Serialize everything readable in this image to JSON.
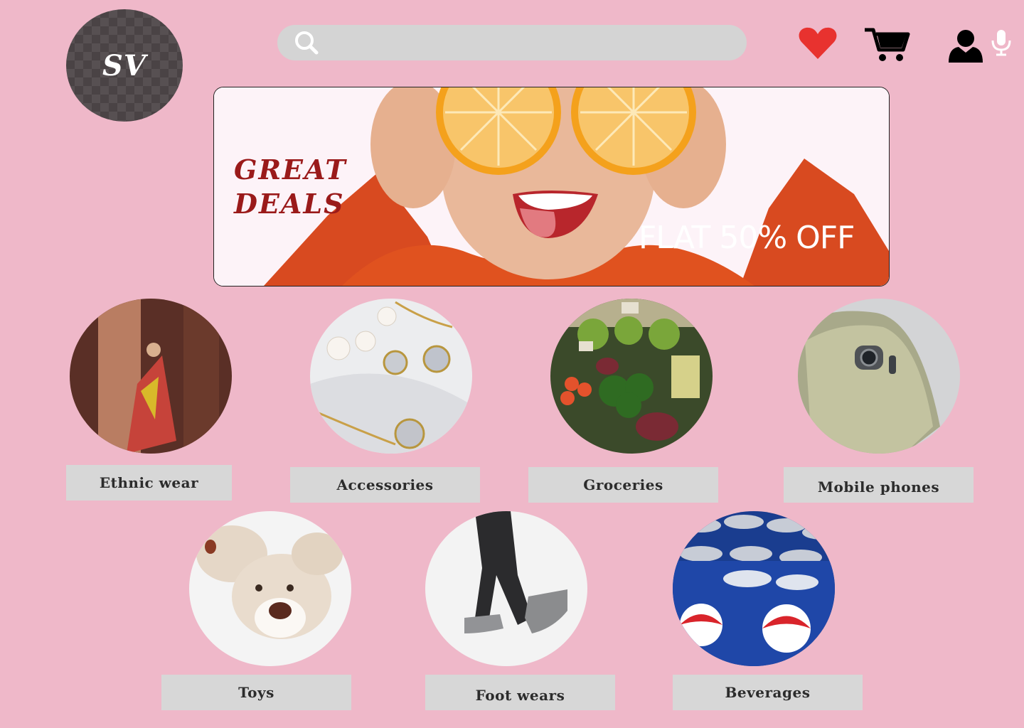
{
  "logo": {
    "text": "SV"
  },
  "search": {
    "placeholder": ""
  },
  "header_icons": [
    "search-icon",
    "mic-icon",
    "heart-icon",
    "cart-icon",
    "user-icon"
  ],
  "banner": {
    "headline_line1": "GREAT",
    "headline_line2": "DEALS",
    "offer": "FLAT 50% OFF"
  },
  "categories": [
    {
      "label": "Ethnic  wear"
    },
    {
      "label": "Accessories"
    },
    {
      "label": "Groceries"
    },
    {
      "label": "Mobile phones"
    },
    {
      "label": "Toys"
    },
    {
      "label": "Foot wears"
    },
    {
      "label": "Beverages"
    }
  ],
  "colors": {
    "background": "#efb8c9",
    "label_bg": "#d7d7d7",
    "heart": "#e8322f",
    "headline": "#9a1a1a"
  }
}
